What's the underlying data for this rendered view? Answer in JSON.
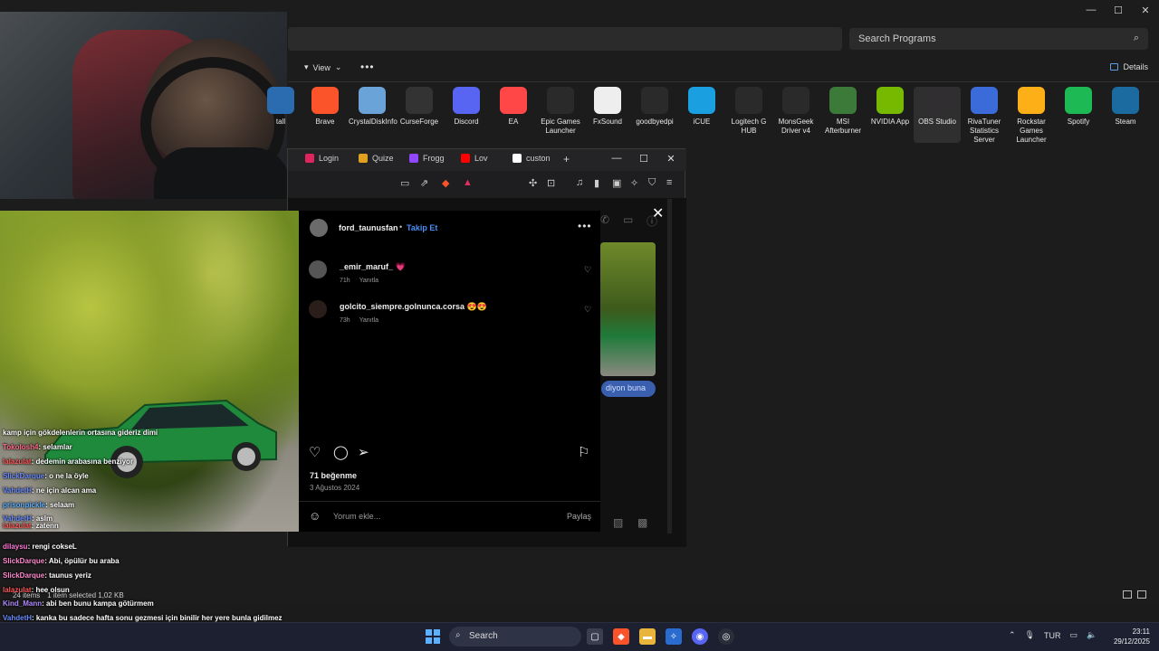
{
  "explorer": {
    "search_placeholder": "Search Programs",
    "view_label": "View",
    "details_label": "Details",
    "status_items": "24 items",
    "status_selected": "1 item selected  1,02 KB",
    "programs": [
      {
        "label": "tall",
        "color": "#2b6cb0"
      },
      {
        "label": "Brave",
        "color": "#fb542b"
      },
      {
        "label": "CrystalDiskInfo",
        "color": "#6aa3d8"
      },
      {
        "label": "CurseForge",
        "color": "#333333"
      },
      {
        "label": "Discord",
        "color": "#5865f2"
      },
      {
        "label": "EA",
        "color": "#ff4747"
      },
      {
        "label": "Epic Games Launcher",
        "color": "#2a2a2a"
      },
      {
        "label": "FxSound",
        "color": "#eeeeee"
      },
      {
        "label": "goodbyedpi",
        "color": "#2a2a2a"
      },
      {
        "label": "iCUE",
        "color": "#1aa0e0"
      },
      {
        "label": "Logitech G HUB",
        "color": "#2a2a2a"
      },
      {
        "label": "MonsGeek Driver v4",
        "color": "#2a2a2a"
      },
      {
        "label": "MSI Afterburner",
        "color": "#3c7a3a"
      },
      {
        "label": "NVIDIA App",
        "color": "#76b900"
      },
      {
        "label": "OBS Studio",
        "color": "#302e31"
      },
      {
        "label": "RivaTuner Statistics Server",
        "color": "#3a6bd8"
      },
      {
        "label": "Rockstar Games Launcher",
        "color": "#fcaf17"
      },
      {
        "label": "Spotify",
        "color": "#1db954"
      },
      {
        "label": "Steam",
        "color": "#1b6aa0"
      }
    ]
  },
  "browser": {
    "tabs": [
      {
        "label": "Login",
        "color": "#e0245e"
      },
      {
        "label": "Quize",
        "color": "#e0a020"
      },
      {
        "label": "Frogg",
        "color": "#9146ff"
      },
      {
        "label": "Lov",
        "color": "#ff0000"
      },
      {
        "label": "custon",
        "color": "#ffffff"
      }
    ],
    "new_tab": "+"
  },
  "instagram": {
    "username": "ford_taunusfan",
    "dot": "•",
    "follow": "Takip Et",
    "comments": [
      {
        "name": "_emir_maruf_ 💗",
        "time": "71h",
        "reply": "Yanıtla"
      },
      {
        "name": "golcito_siempre.golnunca.corsa 😍😍",
        "time": "73h",
        "reply": "Yanıtla"
      }
    ],
    "likes": "71 beğenme",
    "date": "3 Ağustos 2024",
    "comment_placeholder": "Yorum ekle...",
    "share": "Paylaş",
    "dm_text": "diyon buna"
  },
  "chat": [
    {
      "user": "",
      "msg": "kamp için gökdelenlerin ortasına gideriz dimi",
      "color": "#6a8cff"
    },
    {
      "user": "Tokolosh4",
      "msg": ": selamlar",
      "color": "#ff6b8a"
    },
    {
      "user": "lalazulat",
      "msg": ": dedemin arabasına benziyor",
      "color": "#ff5a5a"
    },
    {
      "user": "SlickDarque",
      "msg": ": o ne la öyle",
      "color": "#6a8cff"
    },
    {
      "user": "VahdetH",
      "msg": ": ne için alcan ama",
      "color": "#6a8cff"
    },
    {
      "user": "prisonpickle",
      "msg": ": selaam",
      "color": "#5ab0ff"
    },
    {
      "user": "VahdetH",
      "msg": ": aslm",
      "color": "#6a8cff"
    },
    {
      "user": "lalazulat",
      "msg": ": zatenn",
      "color": "#ff5a5a"
    },
    {
      "user": "dilaysu",
      "msg": ": rengi cokseL",
      "color": "#ff7ad9"
    },
    {
      "user": "SlickDarque",
      "msg": ": Abi, öpülür bu araba",
      "color": "#ff8ad0"
    },
    {
      "user": "SlickDarque",
      "msg": ": taunus yeriz",
      "color": "#ff8ad0"
    },
    {
      "user": "lalazulat",
      "msg": ": hee olsun",
      "color": "#ff5a5a"
    },
    {
      "user": "Kind_Mann",
      "msg": ": abi ben bunu kampa götürmem",
      "color": "#b08aff"
    },
    {
      "user": "VahdetH",
      "msg": ": kanka bu sadece hafta sonu gezmesi için binilir her yere bunla gidilmez",
      "color": "#6a8cff"
    },
    {
      "user": "tadini_almak_sart",
      "msg": "",
      "color": "#ffffff"
    },
    {
      "user": "Tokolosh4",
      "msg": ": yengeeeeeeee naber",
      "color": "#ff6b8a"
    }
  ],
  "taskbar": {
    "search_label": "Search",
    "lang": "TUR",
    "time": "23:11",
    "date": "29/12/2025"
  }
}
